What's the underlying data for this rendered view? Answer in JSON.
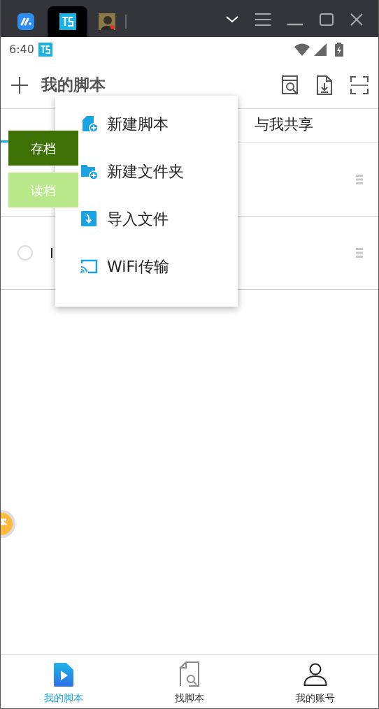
{
  "status_bar": {
    "time": "6:40"
  },
  "header": {
    "title": "我的脚本"
  },
  "tabs": [
    {
      "selected": true
    },
    {
      "label": "与我共享",
      "selected": false
    }
  ],
  "list": [
    {
      "kind": "covered"
    },
    {
      "kind": "script",
      "title": "I",
      "checked": false
    }
  ],
  "menu": [
    {
      "kind": "script",
      "label": "新建脚本"
    },
    {
      "kind": "folder",
      "label": "新建文件夹"
    },
    {
      "kind": "import",
      "label": "导入文件"
    },
    {
      "kind": "wifi",
      "label": "WiFi传输"
    }
  ],
  "floating_buttons": [
    {
      "label": "存档",
      "color": "#3d7005"
    },
    {
      "label": "读档",
      "color": "#b8e88a"
    }
  ],
  "bottom_nav": [
    {
      "kind": "scripts",
      "label": "我的脚本",
      "selected": true
    },
    {
      "kind": "find",
      "label": "找脚本",
      "selected": false
    },
    {
      "kind": "account",
      "label": "我的账号",
      "selected": false
    }
  ]
}
